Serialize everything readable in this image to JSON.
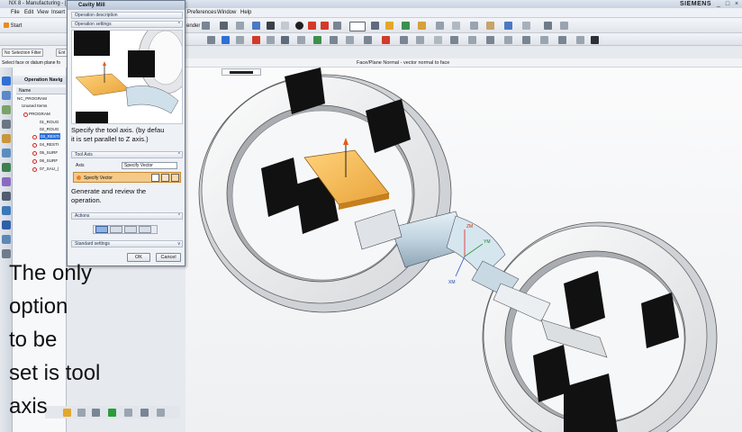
{
  "window": {
    "title": "NX 8 - Manufacturing - [ti",
    "brand": "SIEMENS",
    "controls": [
      "_",
      "□",
      "×"
    ]
  },
  "menubar": {
    "items": [
      "File",
      "Edit",
      "View",
      "Insert",
      "Preferences",
      "Window",
      "Help"
    ],
    "start_label": "Start"
  },
  "toolbar": {
    "fragment": "ender"
  },
  "selection": {
    "filter_value": "No Selection Filter",
    "scope_value": "Ent",
    "prompt": "Select face or datum plane fo"
  },
  "graphics": {
    "header_text": "Face/Plane Normal - vector normal to face",
    "triad": {
      "zm": "ZM",
      "ym": "YM",
      "xm": "XM"
    }
  },
  "navigator": {
    "title": "Operation Navig",
    "column_name": "Name",
    "nodes": [
      {
        "label": "NC_PROGRAM",
        "selected": false
      },
      {
        "label": "Unused Items",
        "selected": false
      },
      {
        "label": "PROGRAM",
        "selected": false
      },
      {
        "label": "01_ROUG",
        "selected": false
      },
      {
        "label": "02_ROUG",
        "selected": false
      },
      {
        "label": "03_RESTI",
        "selected": true
      },
      {
        "label": "04_RESTI",
        "selected": false
      },
      {
        "label": "05_SURF",
        "selected": false
      },
      {
        "label": "06_SURF",
        "selected": false
      },
      {
        "label": "07_SAU_(",
        "selected": false
      }
    ]
  },
  "dialog": {
    "title": "Cavity Mill",
    "section_description": "Operation description",
    "section_settings": "Operation settings",
    "help_tool_axis": [
      "Specify the tool axis. (by defau",
      "it is set parallel to Z axis.)"
    ],
    "tool_axis_section": "Tool Axis",
    "axis_label": "Axis",
    "axis_value": "Specify Vector",
    "specify_vector_label": "Specify Vector",
    "help_generate": [
      "Generate and review the",
      "operation."
    ],
    "actions_section": "Actions",
    "standard_settings_section": "Standard settings",
    "ok_label": "OK",
    "cancel_label": "Cancel"
  },
  "caption": {
    "lines": [
      "The only",
      "option",
      "to be",
      "set is tool",
      "axis"
    ]
  },
  "colors": {
    "accent": "#f0b04a",
    "selection": "#2f6fd6",
    "dialog_caption": "#b8c6d8"
  }
}
